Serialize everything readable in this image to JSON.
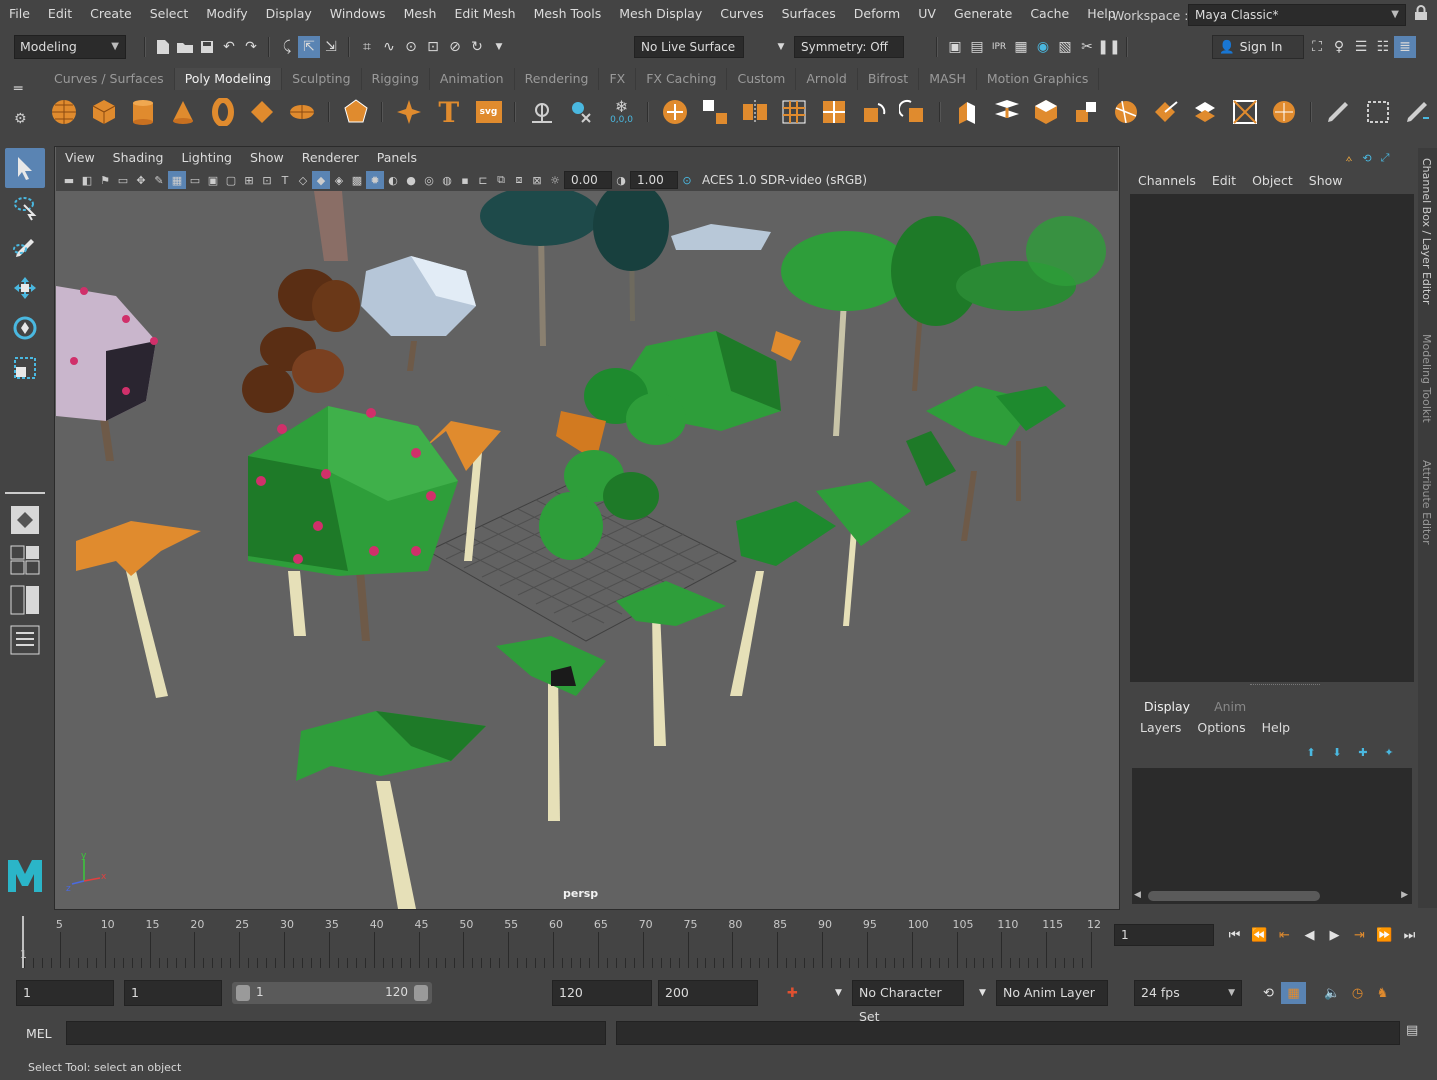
{
  "menubar": {
    "items": [
      "File",
      "Edit",
      "Create",
      "Select",
      "Modify",
      "Display",
      "Windows",
      "Mesh",
      "Edit Mesh",
      "Mesh Tools",
      "Mesh Display",
      "Curves",
      "Surfaces",
      "Deform",
      "UV",
      "Generate",
      "Cache",
      "Help"
    ],
    "workspace_label": "Workspace :",
    "workspace_value": "Maya Classic*"
  },
  "statusline": {
    "menu_set": "Modeling",
    "live_surface": "No Live Surface",
    "symmetry": "Symmetry: Off",
    "sign_in": "Sign In"
  },
  "shelf": {
    "tabs": [
      "Curves / Surfaces",
      "Poly Modeling",
      "Sculpting",
      "Rigging",
      "Animation",
      "Rendering",
      "FX",
      "FX Caching",
      "Custom",
      "Arnold",
      "Bifrost",
      "MASH",
      "Motion Graphics"
    ],
    "active_tab": "Poly Modeling",
    "text_icon": "T",
    "svg_icon": "svg",
    "sweep_label": "0,0,0"
  },
  "viewport": {
    "menu": [
      "View",
      "Shading",
      "Lighting",
      "Show",
      "Renderer",
      "Panels"
    ],
    "near_value": "0.00",
    "far_value": "1.00",
    "color_space": "ACES 1.0 SDR-video (sRGB)",
    "camera": "persp",
    "axis_y": "y",
    "axis_x": "x",
    "axis_z": "z"
  },
  "right_panel": {
    "menu": [
      "Channels",
      "Edit",
      "Object",
      "Show"
    ],
    "vertical_tabs": [
      "Channel Box / Layer Editor",
      "Modeling Toolkit",
      "Attribute Editor"
    ],
    "layer_tabs": [
      "Display",
      "Anim"
    ],
    "active_layer_tab": "Display",
    "layer_menu": [
      "Layers",
      "Options",
      "Help"
    ]
  },
  "timeline": {
    "labels": [
      "5",
      "10",
      "15",
      "20",
      "25",
      "30",
      "35",
      "40",
      "45",
      "50",
      "55",
      "60",
      "65",
      "70",
      "75",
      "80",
      "85",
      "90",
      "95",
      "100",
      "105",
      "110",
      "115",
      "12"
    ],
    "first_frame": "1",
    "current_frame": "1"
  },
  "range": {
    "start": "1",
    "playback_start": "1",
    "slider_start": "1",
    "slider_end": "120",
    "playback_end": "120",
    "end": "200",
    "character_set": "No Character Set",
    "anim_layer": "No Anim Layer",
    "fps": "24 fps"
  },
  "commandline": {
    "language": "MEL"
  },
  "helpline": {
    "text": "Select Tool: select an object"
  },
  "colors": {
    "accent": "#5a84b3",
    "shelf_orange": "#e08b2e",
    "leaf_green": "#2e9e3a",
    "viewport_bg": "#626262"
  }
}
